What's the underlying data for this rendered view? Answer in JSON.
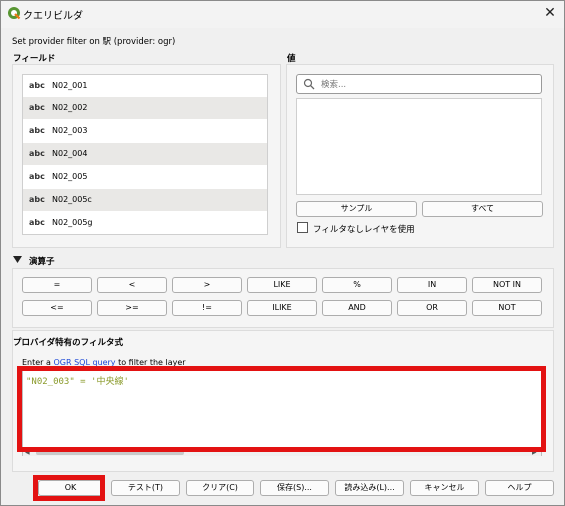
{
  "window": {
    "title": "クエリビルダ",
    "close_glyph": "✕"
  },
  "provider_label": "Set provider filter on 駅 (provider: ogr)",
  "fields": {
    "header": "フィールド",
    "items": [
      {
        "type": "abc",
        "name": "N02_001"
      },
      {
        "type": "abc",
        "name": "N02_002"
      },
      {
        "type": "abc",
        "name": "N02_003"
      },
      {
        "type": "abc",
        "name": "N02_004"
      },
      {
        "type": "abc",
        "name": "N02_005"
      },
      {
        "type": "abc",
        "name": "N02_005c"
      },
      {
        "type": "abc",
        "name": "N02_005g"
      }
    ]
  },
  "values": {
    "header": "値",
    "search_placeholder": "検索...",
    "sample_button": "サンプル",
    "all_button": "すべて",
    "no_filter_checkbox_label": "フィルタなしレイヤを使用"
  },
  "operators": {
    "header": "演算子",
    "row1": [
      "=",
      "<",
      ">",
      "LIKE",
      "%",
      "IN",
      "NOT IN"
    ],
    "row2": [
      "<=",
      ">=",
      "!=",
      "ILIKE",
      "AND",
      "OR",
      "NOT"
    ]
  },
  "provider_filter": {
    "header": "プロバイダ特有のフィルタ式",
    "hint_prefix": "Enter a ",
    "hint_link": "OGR SQL query",
    "hint_suffix": " to filter the layer",
    "expression": "\"N02_003\" = '中央線'"
  },
  "buttons": {
    "ok": "OK",
    "test": "テスト(T)",
    "clear": "クリア(C)",
    "save": "保存(S)...",
    "load": "読み込み(L)...",
    "cancel": "キャンセル",
    "help": "ヘルプ"
  },
  "colors": {
    "highlight_red": "#e31212",
    "link_blue": "#1a47d6",
    "qgis_green": "#589632"
  }
}
